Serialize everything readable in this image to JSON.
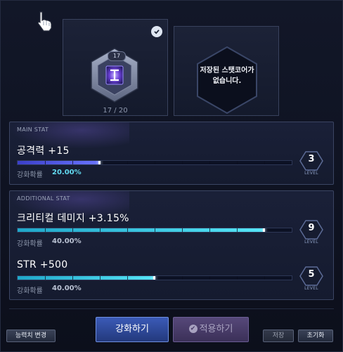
{
  "slots": {
    "core_level": "17",
    "core_count": "17 / 20",
    "empty_message": "저장된 스탯코어가\n없습니다."
  },
  "main_stat": {
    "section_label": "MAIN STAT",
    "name": "공격력 +15",
    "rate_label": "강화확률",
    "rate_value": "20.00%",
    "level": "3",
    "level_word": "LEVEL",
    "progress": 0.3,
    "color": "#6a74ff",
    "rate_color": "#62d9f0"
  },
  "additional_stat": {
    "section_label": "ADDITIONAL STAT",
    "stats": [
      {
        "name": "크리티컬 데미지 +3.15%",
        "rate_label": "강화확률",
        "rate_value": "40.00%",
        "level": "9",
        "level_word": "LEVEL",
        "progress": 0.9,
        "color": "#56e5f7",
        "rate_color": "#b9c1d2"
      },
      {
        "name": "STR +500",
        "rate_label": "강화확률",
        "rate_value": "40.00%",
        "level": "5",
        "level_word": "LEVEL",
        "progress": 0.5,
        "color": "#56e5f7",
        "rate_color": "#b9c1d2"
      }
    ]
  },
  "buttons": {
    "change_stat": "능력치 변경",
    "enhance": "강화하기",
    "apply": "적용하기",
    "save": "저장",
    "reset": "초기화"
  },
  "icons": {
    "cursor": "hand-pointer-icon",
    "selected": "check-circle-icon",
    "core": "stat-core-gem-icon",
    "apply": "check-circle-icon"
  }
}
